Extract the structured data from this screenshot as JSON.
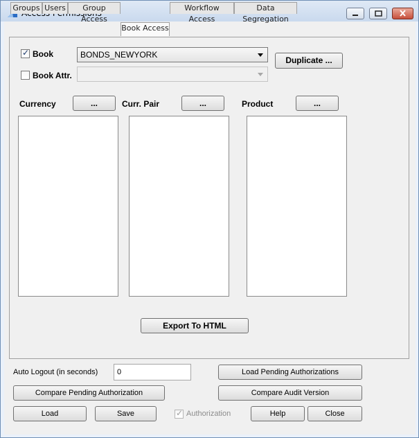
{
  "window": {
    "title": "Access Permissions"
  },
  "tabs": [
    {
      "label": "Groups"
    },
    {
      "label": "Users"
    },
    {
      "label": "Group Access"
    },
    {
      "label": "Book Access"
    },
    {
      "label": "Workflow Access"
    },
    {
      "label": "Data Segregation"
    }
  ],
  "active_tab": "Book Access",
  "book_access": {
    "book_label": "Book",
    "book_checked": true,
    "book_value": "BONDS_NEWYORK",
    "book_attr_label": "Book Attr.",
    "book_attr_checked": false,
    "book_attr_value": "",
    "duplicate_label": "Duplicate ...",
    "currency_label": "Currency",
    "curr_pair_label": "Curr. Pair",
    "product_label": "Product",
    "ellipsis_label": "...",
    "export_label": "Export To HTML"
  },
  "footer": {
    "auto_logout_label": "Auto Logout (in seconds)",
    "auto_logout_value": "0",
    "load_pending_label": "Load Pending Authorizations",
    "compare_pending_label": "Compare Pending Authorization",
    "compare_audit_label": "Compare Audit Version",
    "load_label": "Load",
    "save_label": "Save",
    "authorization_label": "Authorization",
    "authorization_checked": true,
    "help_label": "Help",
    "close_label": "Close"
  }
}
